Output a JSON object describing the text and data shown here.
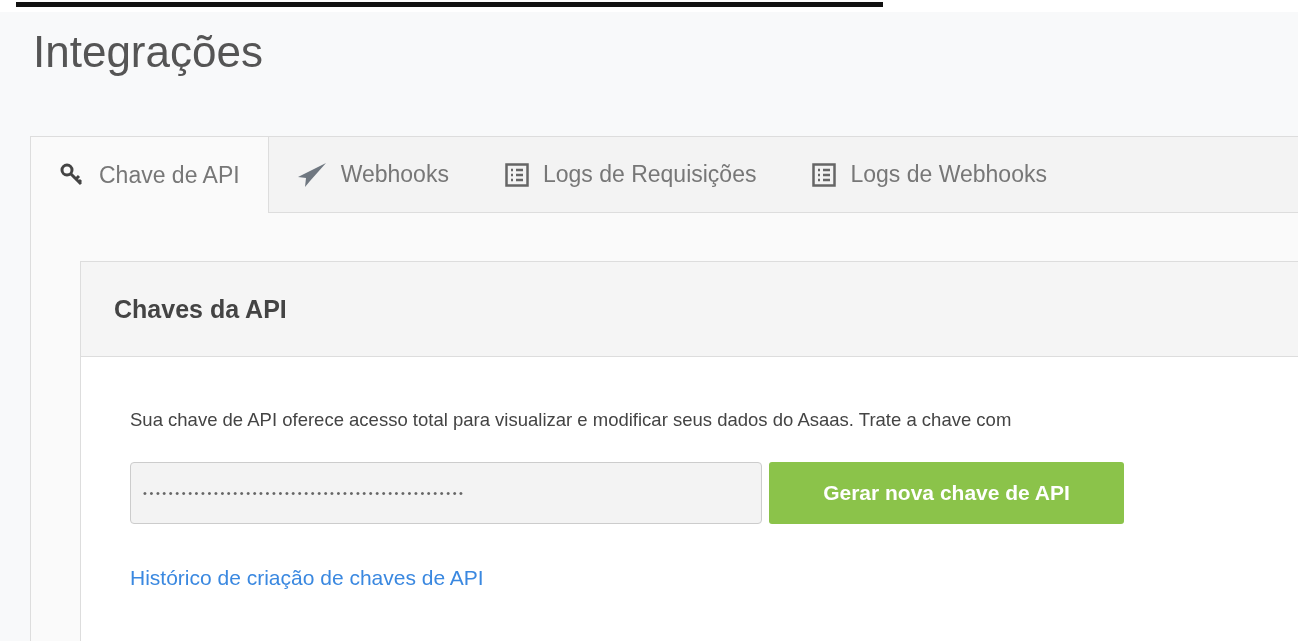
{
  "page_title": "Integrações",
  "tabs": [
    {
      "label": "Chave de API",
      "kind": "key",
      "selected": true
    },
    {
      "label": "Webhooks",
      "kind": "plane",
      "selected": false
    },
    {
      "label": "Logs de Requisições",
      "kind": "list",
      "selected": false
    },
    {
      "label": "Logs de Webhooks",
      "kind": "list",
      "selected": false
    }
  ],
  "card": {
    "title": "Chaves da API",
    "description": "Sua chave de API oferece acesso total para visualizar e modificar seus dados do Asaas. Trate a chave com",
    "api_key_field": {
      "value": "••••••••••••••••••••••••••••••••••••••••••••••••••"
    },
    "generate_button": "Gerar nova chave de API",
    "history_link": "Histórico de criação de chaves de API"
  }
}
